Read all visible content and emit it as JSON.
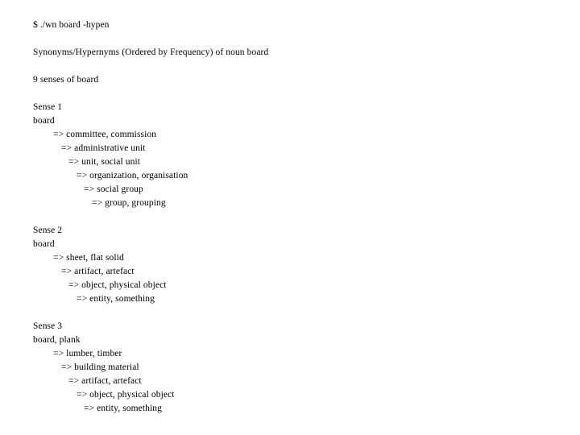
{
  "terminal": {
    "prompt": "$",
    "command_line": "$ ./wn board -hypen",
    "header": "Synonyms/Hypernyms (Ordered by Frequency) of noun board",
    "sense_count_line": "9 senses of board",
    "arrow": "=>",
    "text_color": "#000000",
    "background_color": "#ffffff",
    "senses": [
      {
        "label": "Sense 1",
        "words": "board",
        "hypernyms": [
          {
            "level": 1,
            "text": "=> committee, commission"
          },
          {
            "level": 2,
            "text": "=> administrative unit"
          },
          {
            "level": 3,
            "text": "=> unit, social unit"
          },
          {
            "level": 4,
            "text": "=> organization, organisation"
          },
          {
            "level": 5,
            "text": "=> social group"
          },
          {
            "level": 6,
            "text": "=> group, grouping"
          }
        ]
      },
      {
        "label": "Sense 2",
        "words": "board",
        "hypernyms": [
          {
            "level": 1,
            "text": "=> sheet, flat solid"
          },
          {
            "level": 2,
            "text": "=> artifact, artefact"
          },
          {
            "level": 3,
            "text": "=> object, physical object"
          },
          {
            "level": 4,
            "text": "=> entity, something"
          }
        ]
      },
      {
        "label": "Sense 3",
        "words": "board, plank",
        "hypernyms": [
          {
            "level": 1,
            "text": "=> lumber, timber"
          },
          {
            "level": 2,
            "text": "=> building material"
          },
          {
            "level": 3,
            "text": "=> artifact, artefact"
          },
          {
            "level": 4,
            "text": "=> object, physical object"
          },
          {
            "level": 5,
            "text": "=> entity, something"
          }
        ]
      }
    ]
  }
}
